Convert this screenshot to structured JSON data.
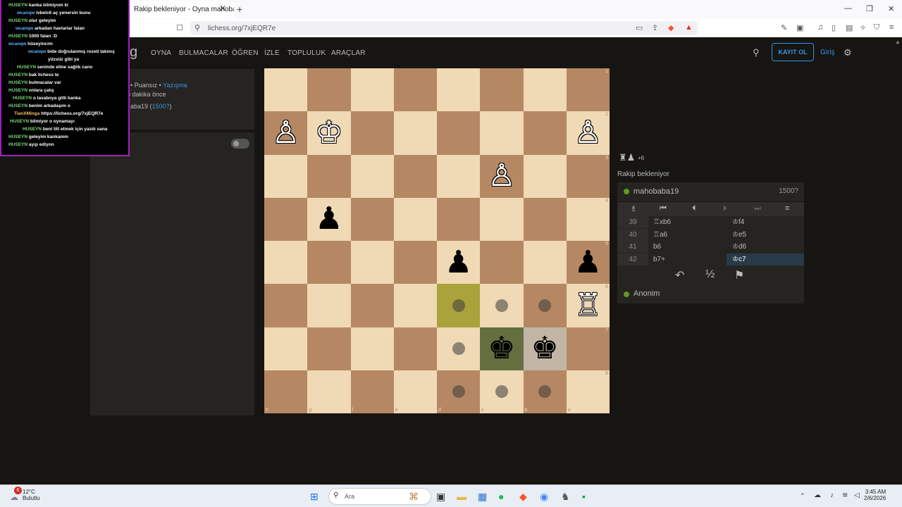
{
  "browser": {
    "tab_title": "Rakip bekleniyor - Oyna mahoba",
    "url": "lichess.org/7xjEQR7e"
  },
  "header": {
    "nav": [
      "OYNA",
      "BULMACALAR",
      "ÖĞREN",
      "İZLE",
      "TOPLULUK",
      "ARAÇLAR"
    ],
    "signup": "KAYIT OL",
    "login": "Giriş"
  },
  "game_info": {
    "type_prefix": "• Puansız •",
    "type_link": "Yazışma",
    "started": "3 dakika önce",
    "player_partial": "aba19",
    "player_rating": "1500?",
    "rating_suffix": ")",
    "rating_prefix": " ("
  },
  "board": {
    "ranks": [
      "1",
      "2",
      "3",
      "4",
      "5",
      "6",
      "7",
      "8"
    ],
    "files": [
      "h",
      "g",
      "f",
      "e",
      "d",
      "c",
      "b",
      "a"
    ]
  },
  "side": {
    "material_plus": "+6",
    "waiting_text": "Rakip bekleniyor",
    "top_player": "mahobaba19",
    "top_rating": "1500?",
    "bottom_player": "Anonim",
    "moves": [
      {
        "num": "39",
        "white": "♖xb6",
        "black": "♔f4"
      },
      {
        "num": "40",
        "white": "♖a6",
        "black": "♔e5"
      },
      {
        "num": "41",
        "white": "b6",
        "black": "♔d6"
      },
      {
        "num": "42",
        "white": "b7+",
        "black": "♔c7"
      }
    ]
  },
  "chat": [
    {
      "user": "HUSEYN",
      "msg": "kanka bilmiyom ki"
    },
    {
      "user": "wcanqw",
      "msg": "ivbelc6 aç yenersin bunu"
    },
    {
      "user": "HUSEYN",
      "msg": "olur geleyim"
    },
    {
      "user": "wcanqw",
      "msg": "arkadan havlarlar falan"
    },
    {
      "user": "HUSEYN",
      "msg": "1000 falan :D"
    },
    {
      "user": "wcanqw",
      "msg": "hüseyincim"
    },
    {
      "user": "wcanqw",
      "msg": "bide doğrulanmış rozeti takmış"
    },
    {
      "user": "",
      "msg": "yüzsüz gibi ya"
    },
    {
      "user": "HUSEYN",
      "msg": "seninde eline sağlık cano"
    },
    {
      "user": "HUSEYN",
      "msg": "bak lichess te"
    },
    {
      "user": "HUSEYN",
      "msg": "bulmacalar var"
    },
    {
      "user": "HUSEYN",
      "msg": "onlara çalış"
    },
    {
      "user": "HUSEYN",
      "msg": "o lavaboya gitti kanka"
    },
    {
      "user": "HUSEYN",
      "msg": "benim arkadaşım o"
    },
    {
      "user": "TianXMinga",
      "msg": "https://lichess.org/7xjEQR7e"
    },
    {
      "user": "HUSEYN",
      "msg": "bilmiyor o oynamayı"
    },
    {
      "user": "HUSEYN",
      "msg": "beni tilt etmek için yazdı sana"
    },
    {
      "user": "HUSEYN",
      "msg": "geleyim kankamm"
    },
    {
      "user": "HUSEYN",
      "msg": "ayıp ediyon"
    }
  ],
  "taskbar": {
    "temp": "12°C",
    "weather": "Bulutlu",
    "search": "Ara",
    "time": "3:45 AM",
    "date": "2/6/2026",
    "badge": "6"
  },
  "colors": {
    "accent": "#3692e7",
    "board_light": "#f0d9b5",
    "board_dark": "#b58863",
    "chat_border": "#a020c0"
  }
}
